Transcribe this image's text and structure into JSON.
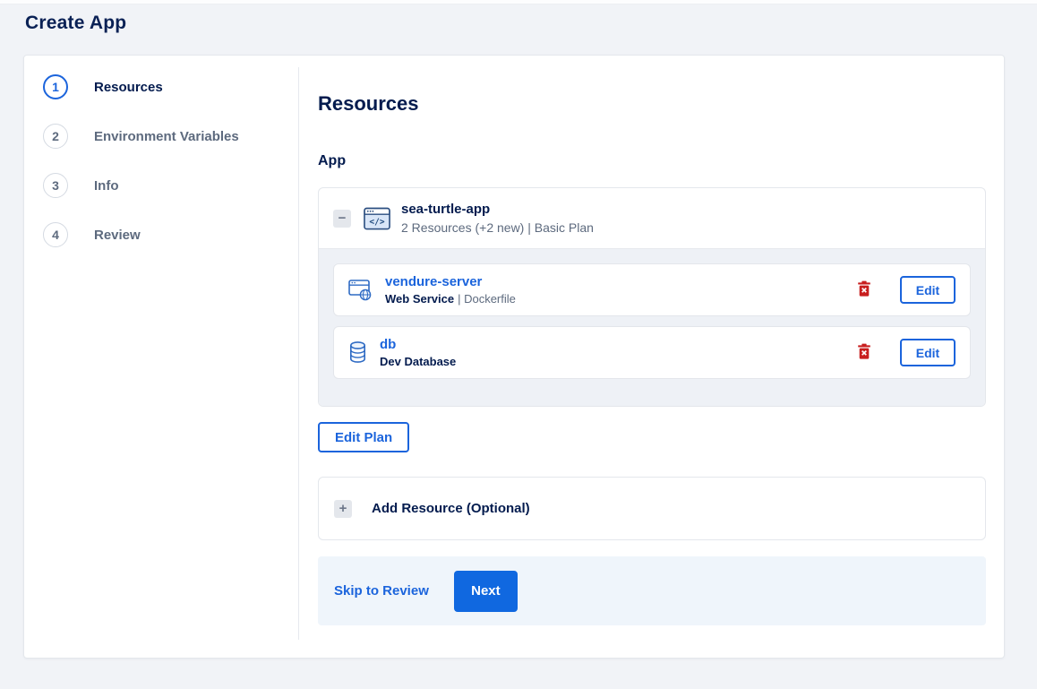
{
  "page": {
    "title": "Create App"
  },
  "colors": {
    "accent": "#1b64dc",
    "next_button": "#1068e0",
    "navy": "#031b4e",
    "muted_text": "#5d6a7e",
    "danger": "#c81e1e",
    "page_bg": "#f1f3f7",
    "group_body_bg": "#eef1f6",
    "footer_bg": "#eff5fb"
  },
  "stepper": {
    "steps": [
      {
        "number": "1",
        "label": "Resources"
      },
      {
        "number": "2",
        "label": "Environment Variables"
      },
      {
        "number": "3",
        "label": "Info"
      },
      {
        "number": "4",
        "label": "Review"
      }
    ]
  },
  "content": {
    "heading": "Resources",
    "section_label": "App",
    "app_group": {
      "name": "sea-turtle-app",
      "summary": "2 Resources (+2 new) | Basic Plan",
      "resources": [
        {
          "name": "vendure-server",
          "type": "Web Service",
          "detail": "| Dockerfile",
          "icon": "web-service-icon",
          "edit_label": "Edit"
        },
        {
          "name": "db",
          "type": "Dev Database",
          "detail": "",
          "icon": "database-icon",
          "edit_label": "Edit"
        }
      ]
    },
    "edit_plan_label": "Edit Plan",
    "add_resource_label": "Add Resource (Optional)",
    "footer": {
      "skip_label": "Skip to Review",
      "next_label": "Next"
    }
  },
  "icons": {
    "collapse_glyph": "−",
    "add_glyph": "+"
  }
}
